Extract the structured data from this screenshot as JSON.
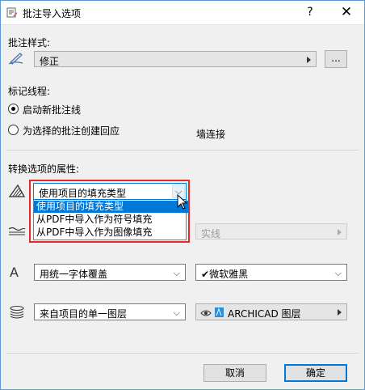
{
  "dialog": {
    "title": "批注导入选项",
    "help_label": "?",
    "close_label": "✕"
  },
  "markup_style": {
    "label": "批注样式:",
    "value": "修正",
    "browse_label": "..."
  },
  "markup_line": {
    "label": "标记线程:",
    "options": [
      "启动新批注线",
      "为选择的批注创建回应"
    ],
    "selected_index": 0,
    "connect_label": "墙连接"
  },
  "convert": {
    "label": "转换选项的属性:",
    "fill": {
      "value": "使用项目的填充类型",
      "options": [
        "使用项目的填充类型",
        "从PDF中导入作为符号填充",
        "从PDF中导入作为图像填充"
      ],
      "highlighted_index": 0
    },
    "line": {
      "value": "实线"
    },
    "font": {
      "mode": "用统一字体覆盖",
      "font_name": "微软雅黑",
      "check": "✔"
    },
    "layer": {
      "mode": "来自项目的单一图层",
      "layer_name": "ARCHICAD 图层"
    }
  },
  "buttons": {
    "cancel": "取消",
    "ok": "确定"
  },
  "colors": {
    "highlight": "#0078d7",
    "callout": "#e32b2b",
    "layer_icon": "#2a8fd8"
  },
  "icons": [
    "pen-icon",
    "fill-icon",
    "line-icon",
    "font-icon",
    "layer-icon",
    "eye-icon",
    "layer-swatch-icon",
    "cursor-icon"
  ]
}
